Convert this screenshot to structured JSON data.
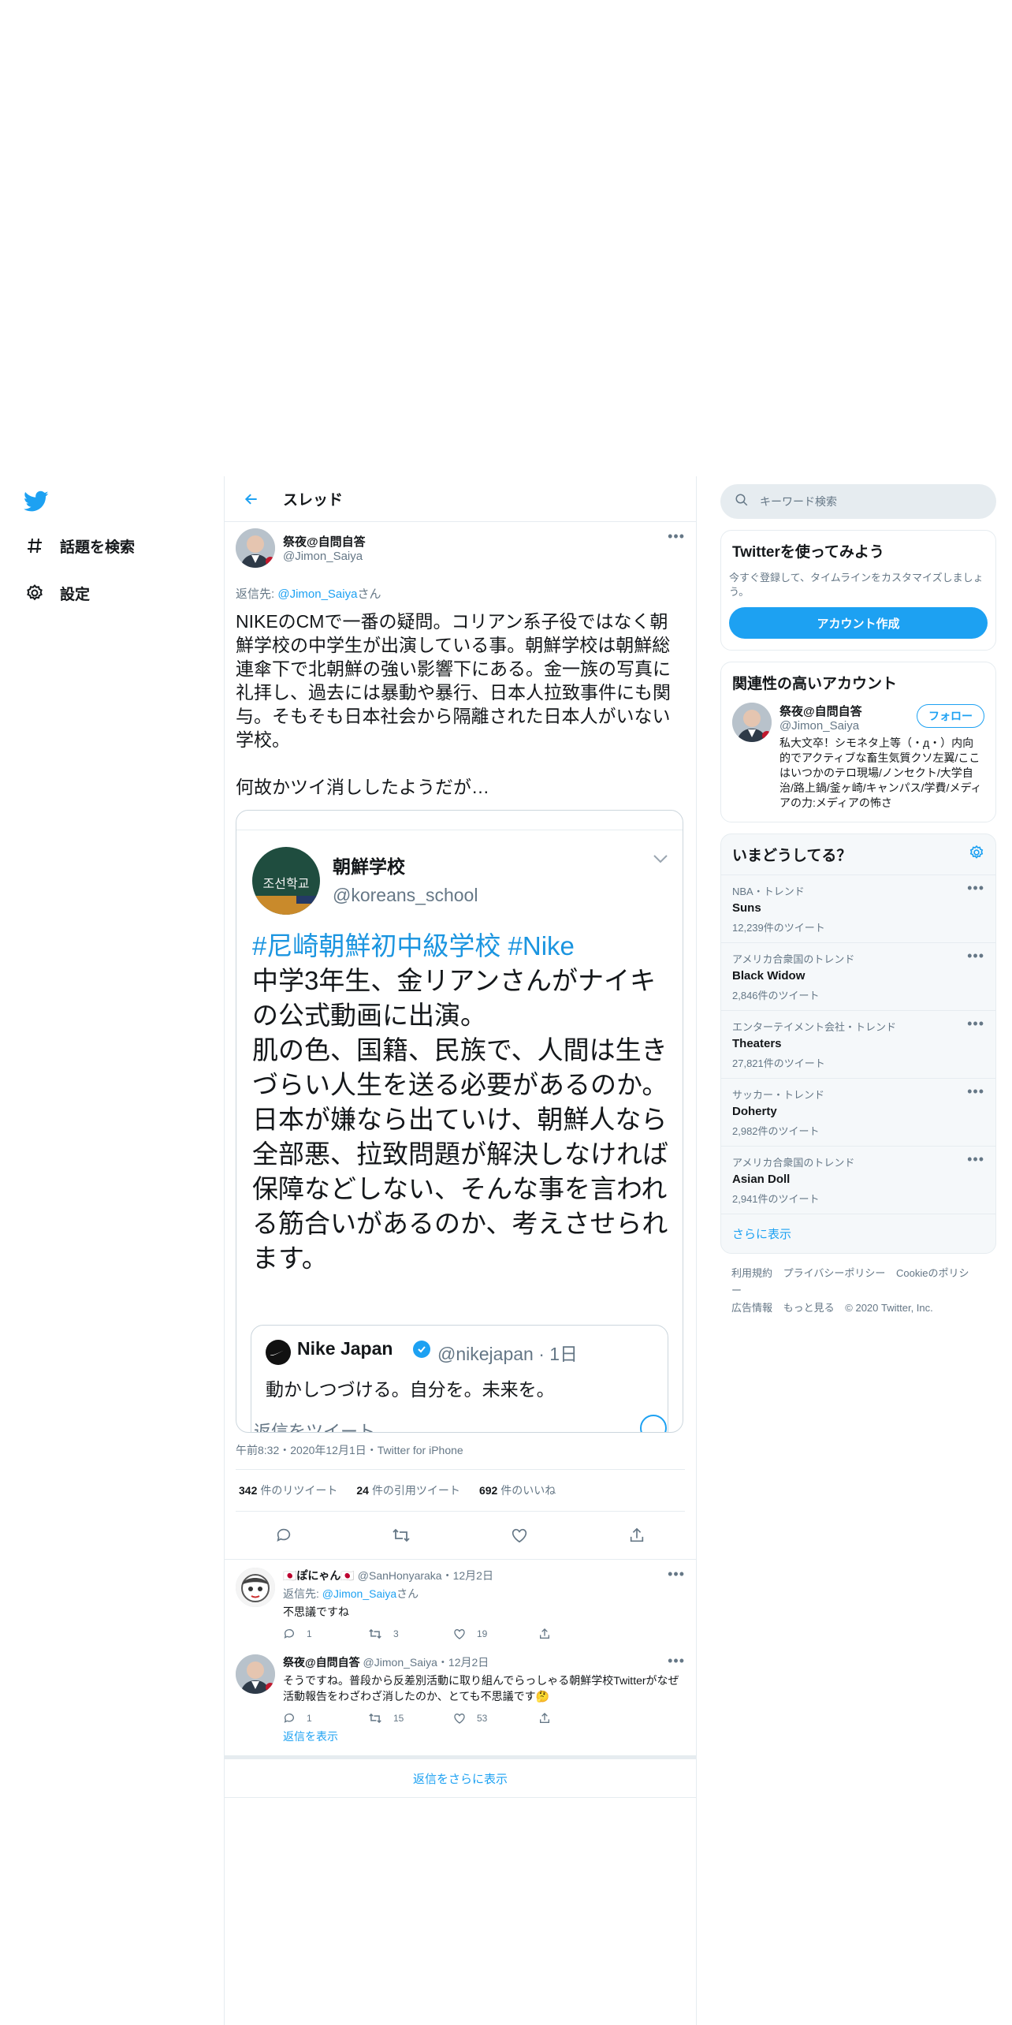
{
  "nav": {
    "explore": "話題を検索",
    "settings": "設定"
  },
  "header": {
    "title": "スレッド"
  },
  "main_tweet": {
    "name": "祭夜@自問自答",
    "handle": "@Jimon_Saiya",
    "reply_prefix": "返信先: ",
    "reply_link": "@Jimon_Saiya",
    "reply_suffix": "さん",
    "body": "NIKEのCMで一番の疑問。コリアン系子役ではなく朝鮮学校の中学生が出演している事。朝鮮学校は朝鮮総連傘下で北朝鮮の強い影響下にある。金一族の写真に礼拝し、過去には暴動や暴行、日本人拉致事件にも関与。そもそも日本社会から隔離された日本人がいない学校。\n\n何故かツイ消ししたようだが…",
    "embedded": {
      "avatar_text": "조선학교",
      "name": "朝鮮学校",
      "handle": "@koreans_school",
      "tags": "#尼崎朝鮮初中級学校 #Nike",
      "line1": "中学3年生、金リアンさんがナイキの公式動画に出演。",
      "line2": "肌の色、国籍、民族で、人間は生きづらい人生を送る必要があるのか。",
      "line3": "日本が嫌なら出ていけ、朝鮮人なら全部悪、拉致問題が解決しなければ保障などしない、そんな事を言われる筋合いがあるのか、考えさせられます。",
      "quote": {
        "name": "Nike Japan",
        "handle": "@nikejapan · 1日",
        "text": "動かしつづける。自分を。未来を。"
      },
      "cut_text": "返信をツイート"
    },
    "meta": "午前8:32・2020年12月1日・Twitter for iPhone",
    "stats": {
      "retweets_num": "342",
      "retweets_label": "件のリツイート",
      "quotes_num": "24",
      "quotes_label": "件の引用ツイート",
      "likes_num": "692",
      "likes_label": "件のいいね"
    }
  },
  "replies": [
    {
      "name": "🇯🇵ぽにゃん🇯🇵",
      "handle": "@SanHonyaraka・12月2日",
      "reply_prefix": "返信先: ",
      "reply_link": "@Jimon_Saiya",
      "reply_suffix": "さん",
      "text": "不思議ですね",
      "replies": "1",
      "retweets": "3",
      "likes": "19"
    },
    {
      "name": "祭夜@自問自答",
      "handle": "@Jimon_Saiya・12月2日",
      "text": "そうですね。普段から反差別活動に取り組んでらっしゃる朝鮮学校Twitterがなぜ活動報告をわざわざ消したのか、とても不思議です🤔",
      "replies": "1",
      "retweets": "15",
      "likes": "53"
    }
  ],
  "show_replies": "返信を表示",
  "show_more_replies": "返信をさらに表示",
  "right": {
    "search_placeholder": "キーワード検索",
    "signup": {
      "title": "Twitterを使ってみよう",
      "desc": "今すぐ登録して、タイムラインをカスタマイズしましょう。",
      "button": "アカウント作成"
    },
    "related": {
      "title": "関連性の高いアカウント",
      "name": "祭夜@自問自答",
      "handle": "@Jimon_Saiya",
      "follow": "フォロー",
      "bio": "私大文卒！シモネタ上等（・д・）内向的でアクティブな畜生気質クソ左翼/ここはいつかのテロ現場/ノンセクト/大学自治/路上鍋/釜ヶ崎/キャンパス/学費/メディアの力:メディアの怖さ"
    },
    "trends": {
      "title": "いまどうしてる？",
      "items": [
        {
          "ctx": "NBA・トレンド",
          "name": "Suns",
          "count": "12,239件のツイート"
        },
        {
          "ctx": "アメリカ合衆国のトレンド",
          "name": "Black Widow",
          "count": "2,846件のツイート"
        },
        {
          "ctx": "エンターテイメント会社・トレンド",
          "name": "Theaters",
          "count": "27,821件のツイート"
        },
        {
          "ctx": "サッカー・トレンド",
          "name": "Doherty",
          "count": "2,982件のツイート"
        },
        {
          "ctx": "アメリカ合衆国のトレンド",
          "name": "Asian Doll",
          "count": "2,941件のツイート"
        }
      ],
      "more": "さらに表示"
    },
    "footer": {
      "terms": "利用規約",
      "privacy": "プライバシーポリシー",
      "cookie": "Cookieのポリシー",
      "ads": "広告情報",
      "more": "もっと見る",
      "copyright": "© 2020 Twitter, Inc."
    }
  },
  "colors": {
    "accent": "#1da1f2",
    "text": "#14171a",
    "muted": "#657786",
    "border": "#e6ecf0"
  }
}
